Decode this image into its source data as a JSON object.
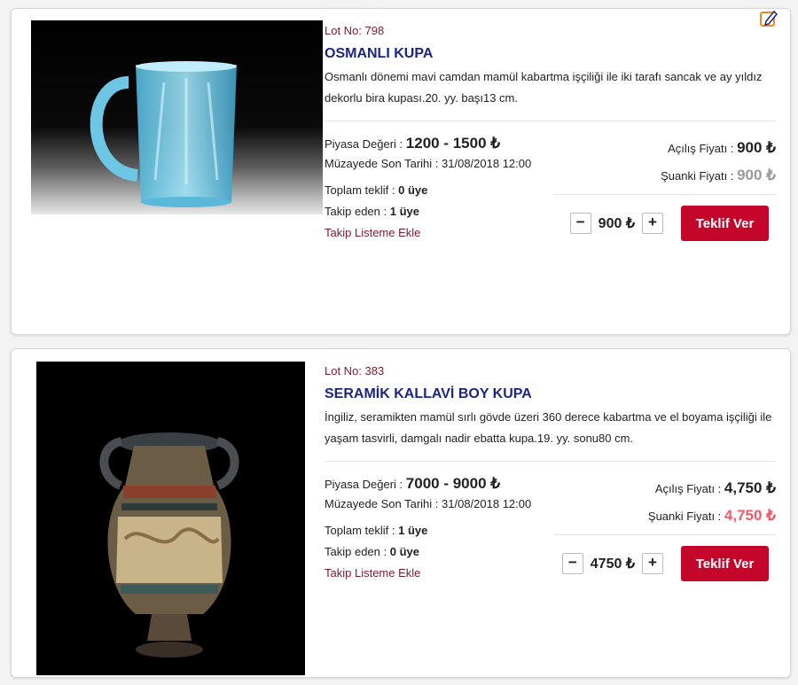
{
  "lots": [
    {
      "lot_label": "Lot No: 798",
      "title": "OSMANLI KUPA",
      "description": "Osmanlı dönemi mavi camdan mamül kabartma işçiliği ile iki tarafı sancak ve ay yıldız dekorlu bira kupası.20. yy. başı13 cm.",
      "market_value_label": "Piyasa Değeri :",
      "market_value": "1200 - 1500 ₺",
      "deadline_label": "Müzayede Son Tarihi :",
      "deadline": "31/08/2018 12:00",
      "total_bids_label": "Toplam teklif :",
      "total_bids": "0 üye",
      "followers_label": "Takip eden :",
      "followers": "1 üye",
      "watch_label": "Takip Listeme Ekle",
      "opening_price_label": "Açılış Fiyatı :",
      "opening_price": "900 ₺",
      "current_price_label": "Şuanki Fiyatı :",
      "current_price": "900 ₺",
      "current_price_color": "#9a9a9a",
      "bid_amount": "900 ₺",
      "minus_label": "−",
      "plus_label": "+",
      "offer_button": "Teklif Ver",
      "image_icon": "glass-mug-photo"
    },
    {
      "lot_label": "Lot No: 383",
      "title": "SERAMİK KALLAVİ BOY KUPA",
      "description": "İngiliz, seramikten mamül sırlı gövde üzeri 360 derece kabartma ve el boyama işçiliği ile yaşam tasvirli, damgalı nadir ebatta kupa.19. yy. sonu80 cm.",
      "market_value_label": "Piyasa Değeri :",
      "market_value": "7000 - 9000 ₺",
      "deadline_label": "Müzayede Son Tarihi :",
      "deadline": "31/08/2018 12:00",
      "total_bids_label": "Toplam teklif :",
      "total_bids": "1 üye",
      "followers_label": "Takip eden :",
      "followers": "0 üye",
      "watch_label": "Takip Listeme Ekle",
      "opening_price_label": "Açılış Fiyatı :",
      "opening_price": "4,750 ₺",
      "current_price_label": "Şuanki Fiyatı :",
      "current_price": "4,750 ₺",
      "current_price_color": "#ef5a6b",
      "bid_amount": "4750 ₺",
      "minus_label": "−",
      "plus_label": "+",
      "offer_button": "Teklif Ver",
      "image_icon": "ceramic-vase-photo"
    }
  ],
  "colors": {
    "accent": "#c4062b",
    "title_blue": "#1c2580",
    "lot_maroon": "#7a1b30",
    "edit_icon_orange": "#f08a1c"
  }
}
